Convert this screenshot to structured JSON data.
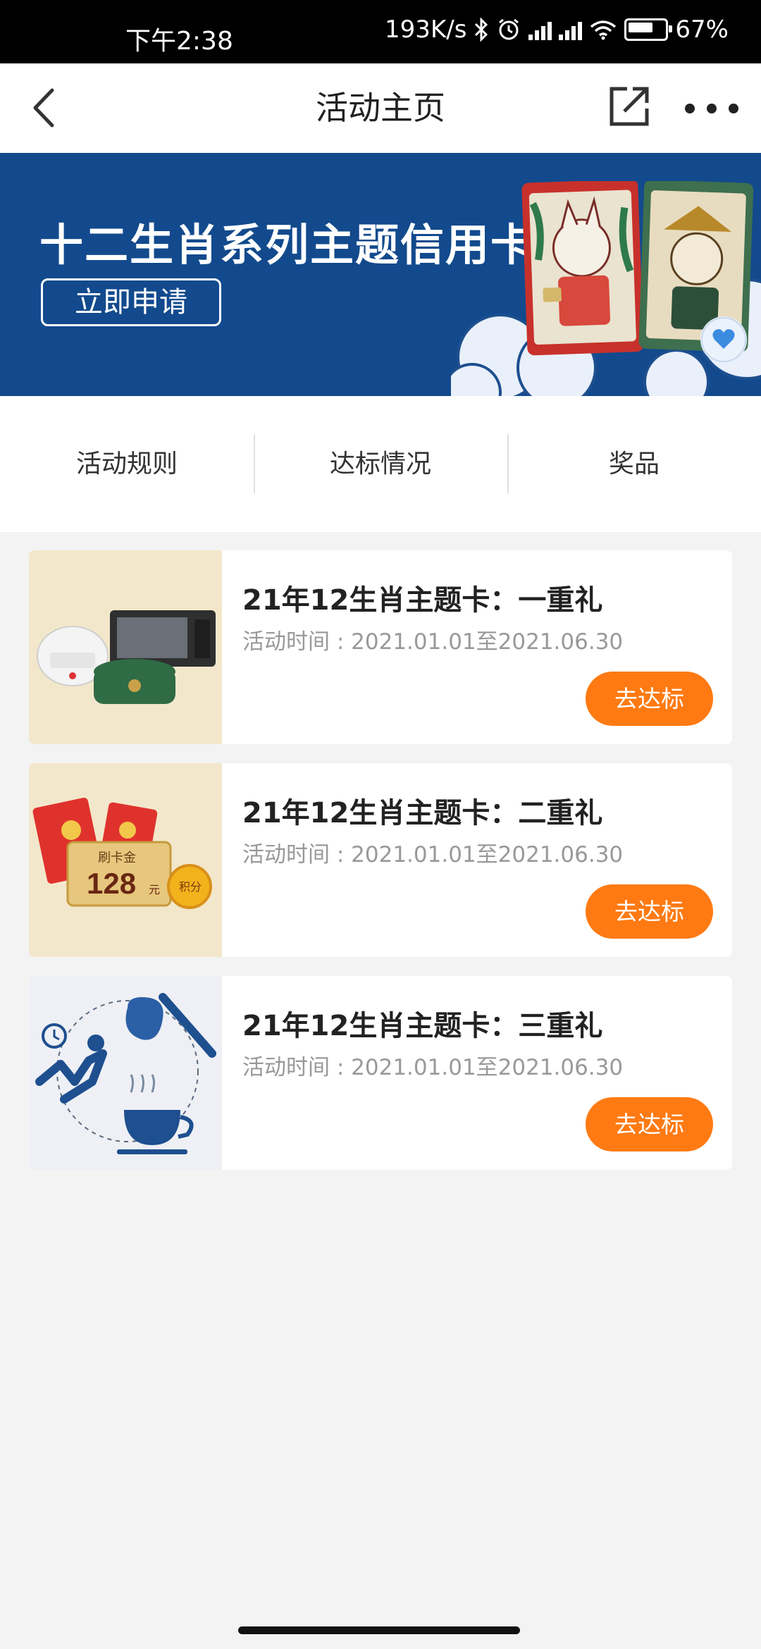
{
  "status_bar": {
    "time": "下午2:38",
    "net_speed": "193K/s",
    "battery": "67%",
    "icons": [
      "bluetooth-icon",
      "alarm-icon",
      "signal-hd-icon",
      "signal-hd-icon",
      "wifi-icon",
      "battery-icon"
    ]
  },
  "header": {
    "title": "活动主页",
    "back_icon": "chevron-left-icon",
    "share_icon": "share-icon",
    "more_icon": "more-dots-icon"
  },
  "banner": {
    "title": "十二生肖系列主题信用卡",
    "apply_label": "立即申请",
    "favorite_icon": "heart-icon",
    "background_color": "#124a8d"
  },
  "tabs": [
    {
      "label": "活动规则"
    },
    {
      "label": "达标情况"
    },
    {
      "label": "奖品"
    }
  ],
  "activities": [
    {
      "title": "21年12生肖主题卡：一重礼",
      "time": "活动时间 : 2021.01.01至2021.06.30",
      "button": "去达标",
      "image": "appliances-image"
    },
    {
      "title": "21年12生肖主题卡：二重礼",
      "time": "活动时间 : 2021.01.01至2021.06.30",
      "button": "去达标",
      "image": "cash-coupon-image"
    },
    {
      "title": "21年12生肖主题卡：三重礼",
      "time": "活动时间 : 2021.01.01至2021.06.30",
      "button": "去达标",
      "image": "services-image"
    }
  ],
  "thumb_text": {
    "coupon_label": "刷卡金",
    "coupon_value": "128",
    "coupon_unit": "元",
    "points_label": "积分"
  },
  "colors": {
    "accent": "#ff7a12",
    "brand_blue": "#124a8d"
  }
}
